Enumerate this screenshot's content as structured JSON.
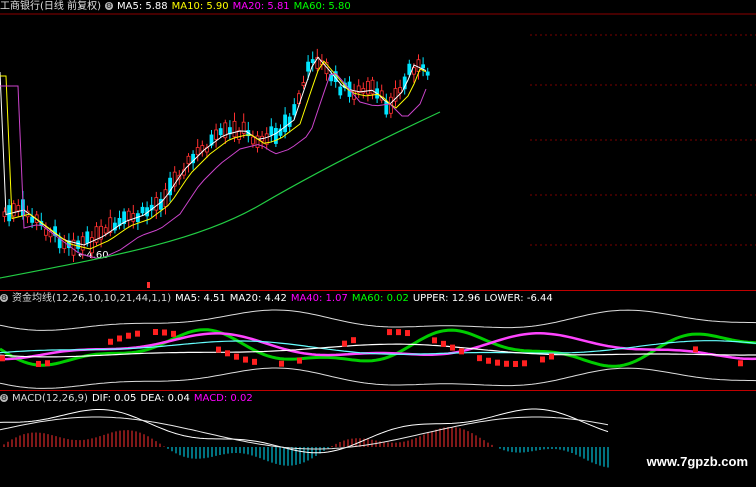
{
  "price_panel": {
    "title": "工商银行(日线 前复权)",
    "ma_labels": [
      {
        "text": "MA5: 5.88",
        "color": "#ffffff"
      },
      {
        "text": "MA10: 5.90",
        "color": "#ffff00"
      },
      {
        "text": "MA20: 5.81",
        "color": "#ff00ff"
      },
      {
        "text": "MA60: 5.80",
        "color": "#00ff00"
      }
    ],
    "low_annotation": "←4.60",
    "colors": {
      "up": "#ff3030",
      "down": "#00e5ff",
      "ma5": "#ffffff",
      "ma10": "#ffff00",
      "ma20": "#cc44cc",
      "ma60": "#22cc44"
    }
  },
  "fund_panel": {
    "title": "资金均线(12,26,10,10,21,44,1,1)",
    "labels": [
      {
        "text": "MA5: 4.51",
        "color": "#ffffff"
      },
      {
        "text": "MA20: 4.42",
        "color": "#ffffff"
      },
      {
        "text": "MA40: 1.07",
        "color": "#ff00ff"
      },
      {
        "text": "MA60: 0.02",
        "color": "#00ff00"
      },
      {
        "text": "UPPER: 12.96",
        "color": "#ffffff"
      },
      {
        "text": "LOWER: -6.44",
        "color": "#ffffff"
      }
    ]
  },
  "macd_panel": {
    "title": "MACD(12,26,9)",
    "labels": [
      {
        "text": "DIF: 0.05",
        "color": "#ffffff"
      },
      {
        "text": "DEA: 0.04",
        "color": "#ffffff"
      },
      {
        "text": "MACD: 0.02",
        "color": "#ff00ff"
      }
    ]
  },
  "watermark": "www.7gpzb.com"
}
